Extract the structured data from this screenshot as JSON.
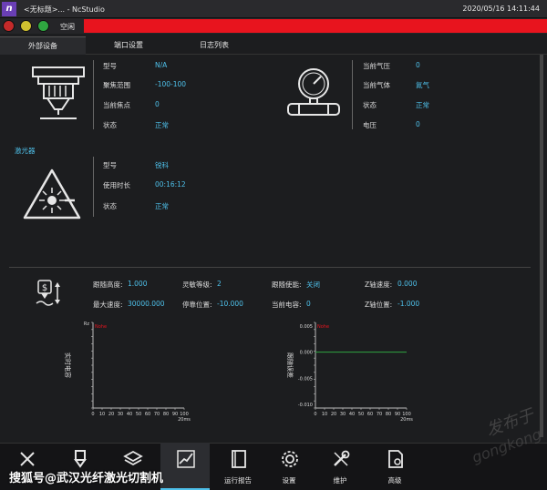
{
  "window": {
    "title": "<无标题>... - NcStudio",
    "datetime": "2020/05/16 14:11:44",
    "logo": "n"
  },
  "status": {
    "state": "空闲",
    "alarm_color": "#e8141e"
  },
  "tabs": [
    "外部设备",
    "端口设置",
    "日志列表"
  ],
  "head": {
    "labels": [
      "型号",
      "聚焦范围",
      "当前焦点",
      "状态"
    ],
    "values": [
      "N/A",
      "-100-100",
      "0",
      "正常"
    ]
  },
  "gas": {
    "labels": [
      "当前气压",
      "当前气体",
      "状态",
      "电压"
    ],
    "values": [
      "0",
      "氮气",
      "正常",
      "0"
    ]
  },
  "laser": {
    "title": "激光器",
    "labels": [
      "型号",
      "使用时长",
      "状态"
    ],
    "values": [
      "锐科",
      "00:16:12",
      "正常"
    ]
  },
  "follow": {
    "row1": [
      {
        "label": "跟随高度:",
        "value": "1.000"
      },
      {
        "label": "灵敏等级:",
        "value": "2"
      },
      {
        "label": "跟随使能:",
        "value": "关闭"
      },
      {
        "label": "Z轴速度:",
        "value": "0.000"
      }
    ],
    "row2": [
      {
        "label": "最大速度:",
        "value": "30000.000"
      },
      {
        "label": "停靠位置:",
        "value": "-10.000"
      },
      {
        "label": "当前电容:",
        "value": "0"
      },
      {
        "label": "Z轴位置:",
        "value": "-1.000"
      }
    ]
  },
  "chart_data": [
    {
      "type": "line",
      "ylabel": "实时电容",
      "y_top_label": "Rz",
      "legend_text": "Nohe",
      "x_ticks": [
        "0",
        "10",
        "20",
        "30",
        "40",
        "50",
        "60",
        "70",
        "80",
        "90",
        "100"
      ],
      "x_unit": "20ms",
      "series": []
    },
    {
      "type": "line",
      "ylabel": "跟随误差",
      "y_ticks": [
        "0.005",
        "0.000",
        "-0.005",
        "-0.010"
      ],
      "legend_text": "Nohe",
      "x_ticks": [
        "0",
        "10",
        "20",
        "30",
        "40",
        "50",
        "60",
        "70",
        "80",
        "90",
        "100"
      ],
      "x_unit": "20ms",
      "series": [
        {
          "x": [
            0,
            100
          ],
          "values": [
            0,
            0
          ],
          "color": "#2fa640"
        }
      ]
    }
  ],
  "nav": {
    "items": [
      "",
      "",
      "",
      "",
      "运行报告",
      "设置",
      "维护",
      "高级"
    ]
  },
  "watermark": {
    "left": "搜狐号@武汉光纤激光切割机",
    "right1": "发布于",
    "right2": "gongkong"
  }
}
